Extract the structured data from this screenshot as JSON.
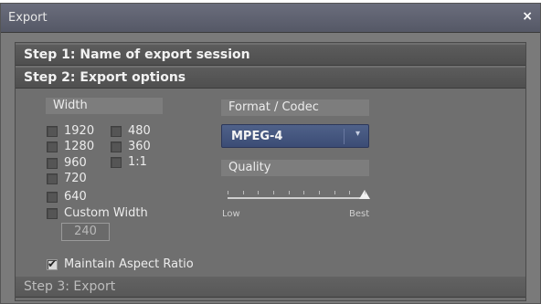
{
  "window": {
    "title": "Export",
    "close_glyph": "×"
  },
  "steps": {
    "step1": "Step 1: Name of export session",
    "step2": "Step 2: Export options",
    "step3": "Step 3: Export"
  },
  "width_section": {
    "label": "Width",
    "options_col1": [
      {
        "label": "1920",
        "checked": false
      },
      {
        "label": "1280",
        "checked": false
      },
      {
        "label": "960",
        "checked": false
      },
      {
        "label": "720",
        "checked": false
      },
      {
        "label": "640",
        "checked": false
      }
    ],
    "options_col2": [
      {
        "label": "480",
        "checked": false
      },
      {
        "label": "360",
        "checked": false
      },
      {
        "label": "1:1",
        "checked": false
      }
    ],
    "custom_width": {
      "label": "Custom Width",
      "checked": false,
      "value": "240"
    },
    "maintain_aspect": {
      "label": "Maintain Aspect Ratio",
      "checked": true
    }
  },
  "format_section": {
    "label": "Format / Codec",
    "selected": "MPEG-4",
    "arrow_icon": "chevron-down-icon"
  },
  "quality_section": {
    "label": "Quality",
    "min_label": "Low",
    "max_label": "Best",
    "value_fraction": 1.0,
    "tick_count": 10
  },
  "colors": {
    "select_bg": "#45567f",
    "panel_bg": "#6f6f6f"
  }
}
